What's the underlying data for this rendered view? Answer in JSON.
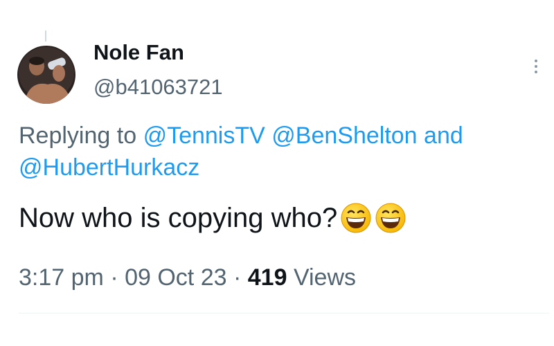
{
  "tweet": {
    "author": {
      "display_name": "Nole Fan",
      "handle": "@b41063721",
      "avatar": "avatar-photo"
    },
    "reply": {
      "prefix": "Replying to",
      "mention_1": "@TennisTV",
      "mention_2": "@BenShelton",
      "conjunction": "and",
      "mention_3": "@HubertHurkacz"
    },
    "text": "Now who is copying who?",
    "emojis": [
      "grinning-face-emoji",
      "grinning-face-emoji"
    ],
    "meta": {
      "time": "3:17 pm",
      "separator_1": "·",
      "date": "09 Oct 23",
      "separator_2": "·",
      "views_count": "419",
      "views_label": "Views"
    },
    "more_icon": "more-dots-icon"
  },
  "colors": {
    "text": "#0f1419",
    "secondary": "#536471",
    "link": "#1d9bf0",
    "divider": "#eff3f4"
  }
}
